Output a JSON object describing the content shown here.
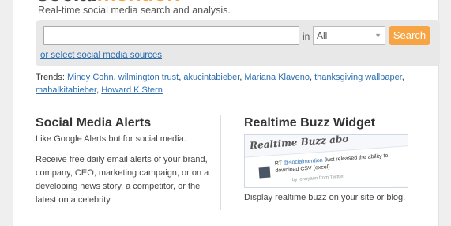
{
  "header": {
    "logo_dark": "social",
    "logo_accent": "mention",
    "tagline": "Real-time social media search and analysis."
  },
  "search": {
    "input_value": "",
    "in_label": "in",
    "source_selected": "All",
    "button_label": "Search",
    "sources_link": "or select social media sources"
  },
  "trends": {
    "label": "Trends:",
    "items": [
      "Mindy Cohn",
      "wilmington trust",
      "akucintabieber",
      "Mariana Klaveno",
      "thanksgiving wallpaper",
      "mahalkitabieber",
      "Howard K Stern"
    ]
  },
  "alerts": {
    "title": "Social Media Alerts",
    "subtitle": "Like Google Alerts but for social media.",
    "body": "Receive free daily email alerts of your brand, company, CEO, marketing campaign, or on a developing news story, a competitor, or the latest on a celebrity."
  },
  "widget": {
    "title": "Realtime Buzz Widget",
    "image_title": "Realtime Buzz abo",
    "tweet_prefix": "RT",
    "tweet_handle": "@socialmention",
    "tweet_text": "Just released the ability to download CSV (excel)",
    "tweet_meta": "by jonnyaon from Twitter",
    "caption": "Display realtime buzz on your site or blog."
  },
  "colors": {
    "accent": "#f7a544",
    "link": "#2a6db0",
    "panel": "#e8e8e8"
  }
}
